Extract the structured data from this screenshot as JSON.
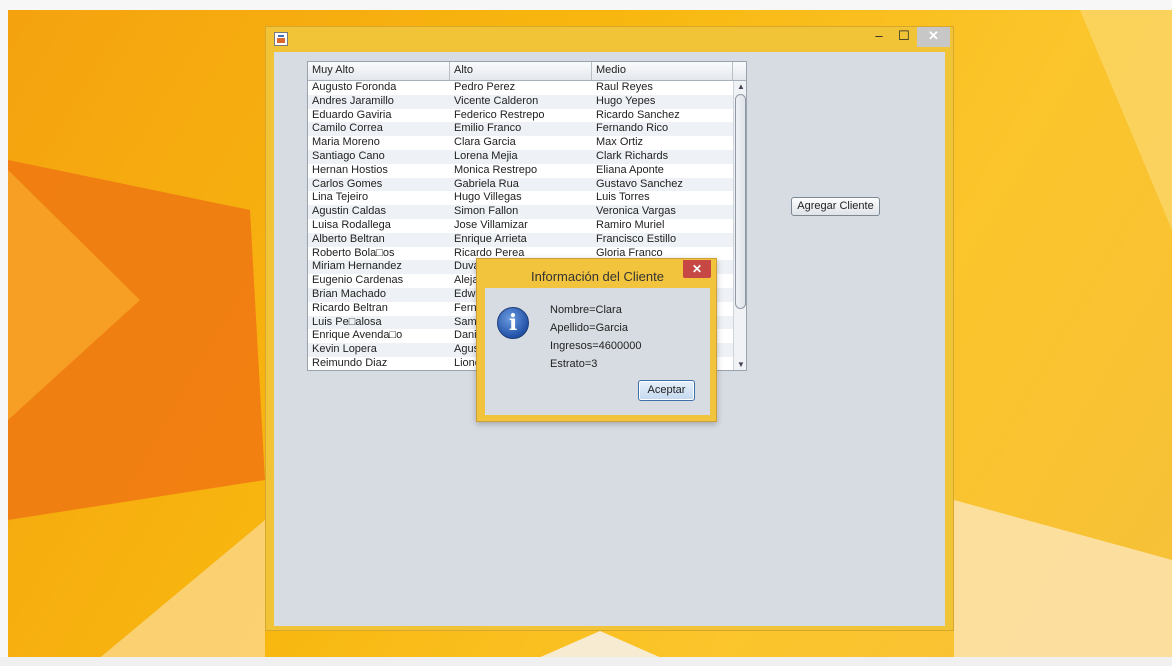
{
  "window": {
    "title": "",
    "controls": {
      "minimize": "–",
      "maximize": "☐",
      "close": "✕"
    }
  },
  "table": {
    "columns": [
      "Muy Alto",
      "Alto",
      "Medio"
    ],
    "rows": [
      [
        "Augusto Foronda",
        "Pedro Perez",
        "Raul Reyes"
      ],
      [
        "Andres Jaramillo",
        "Vicente Calderon",
        "Hugo Yepes"
      ],
      [
        "Eduardo Gaviria",
        "Federico Restrepo",
        "Ricardo Sanchez"
      ],
      [
        "Camilo Correa",
        "Emilio Franco",
        "Fernando Rico"
      ],
      [
        "Maria Moreno",
        "Clara Garcia",
        "Max Ortiz"
      ],
      [
        "Santiago Cano",
        "Lorena Mejia",
        "Clark Richards"
      ],
      [
        "Hernan Hostios",
        "Monica Restrepo",
        "Eliana Aponte"
      ],
      [
        "Carlos Gomes",
        "Gabriela Rua",
        "Gustavo Sanchez"
      ],
      [
        "Lina Tejeiro",
        "Hugo Villegas",
        "Luis Torres"
      ],
      [
        "Agustin Caldas",
        "Simon Fallon",
        "Veronica Vargas"
      ],
      [
        "Luisa Rodallega",
        "Jose Villamizar",
        "Ramiro Muriel"
      ],
      [
        "Alberto Beltran",
        "Enrique Arrieta",
        "Francisco Estillo"
      ],
      [
        "Roberto Bola□os",
        "Ricardo Perea",
        "Gloria Franco"
      ],
      [
        "Miriam Hernandez",
        "Duva",
        ""
      ],
      [
        "Eugenio Cardenas",
        "Aleja",
        ""
      ],
      [
        "Brian Machado",
        "Edwi",
        ""
      ],
      [
        "Ricardo Beltran",
        "Ferna",
        ""
      ],
      [
        "Luis Pe□alosa",
        "Samu",
        ""
      ],
      [
        "Enrique Avenda□o",
        "Danie",
        ""
      ],
      [
        "Kevin Lopera",
        "Agust",
        ""
      ],
      [
        "Reimundo Diaz",
        "Lione",
        ""
      ]
    ],
    "scroll_up": "▲",
    "scroll_down": "▼"
  },
  "add_button": {
    "label": "Agregar Cliente"
  },
  "dialog": {
    "title": "Información del Cliente",
    "close": "✕",
    "icon": "i",
    "lines": [
      "Nombre=Clara",
      "Apellido=Garcia",
      "Ingresos=4600000",
      "Estrato=3"
    ],
    "ok_label": "Aceptar"
  },
  "colors": {
    "wallpaper": "#f8b70f",
    "dialog_frame": "#f2c43d",
    "client_area": "#d7dce2",
    "dialog_close": "#c64743"
  }
}
